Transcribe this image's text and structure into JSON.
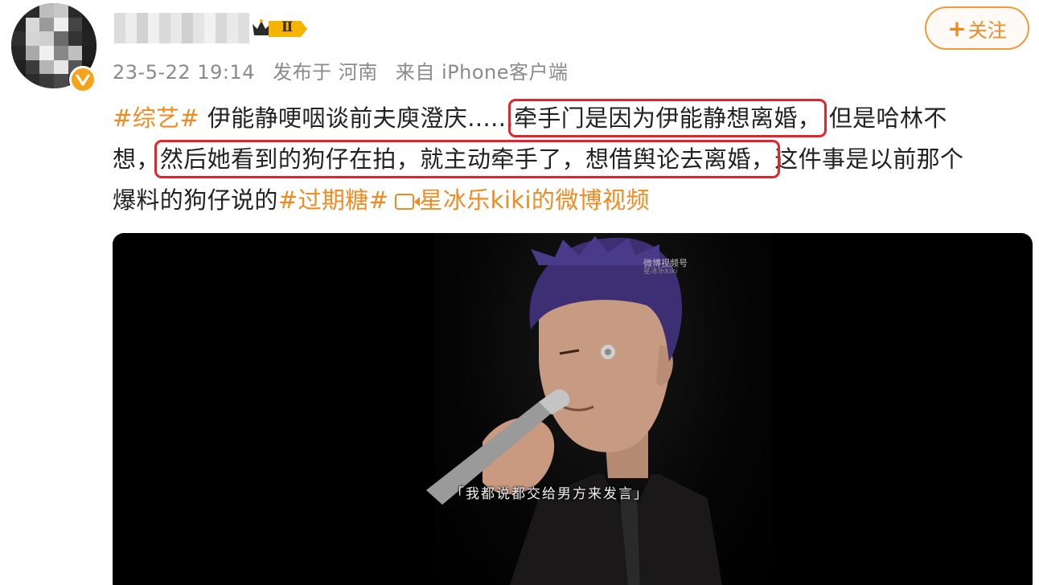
{
  "post": {
    "level_badge": "Ⅱ",
    "timestamp": "23-5-22 19:14",
    "published_in": "发布于 河南",
    "source": "来自 iPhone客户端",
    "follow_label": "关注",
    "follow_plus": "+"
  },
  "content": {
    "line1": {
      "tag": "#综艺#",
      "text_a": " 伊能静哽咽谈前夫庾澄庆......",
      "highlight": "牵手门是因为伊能静想离婚，",
      "text_b": " 但是哈林不"
    },
    "line2": {
      "text_a": "想，",
      "highlight": "然后她看到的狗仔在拍，就主动牵手了，想借舆论去离婚，",
      "text_b": "这件事是以前那个"
    },
    "line3": {
      "text_a": "爆料的狗仔说的",
      "tag": "#过期糖#",
      "link": "星冰乐kiki的微博视频"
    }
  },
  "video": {
    "watermark_top": "微博视频号",
    "watermark_bottom": "星冰乐kiki",
    "subtitle": "「我都说都交给男方来发言」"
  },
  "colors": {
    "accent": "#f08a22",
    "highlight_box": "#e3242b",
    "meta_text": "#8a8a8a",
    "verified": "#f7a21b"
  },
  "icons": [
    "verified-icon",
    "crown-icon",
    "video-icon",
    "weibo-icon"
  ]
}
